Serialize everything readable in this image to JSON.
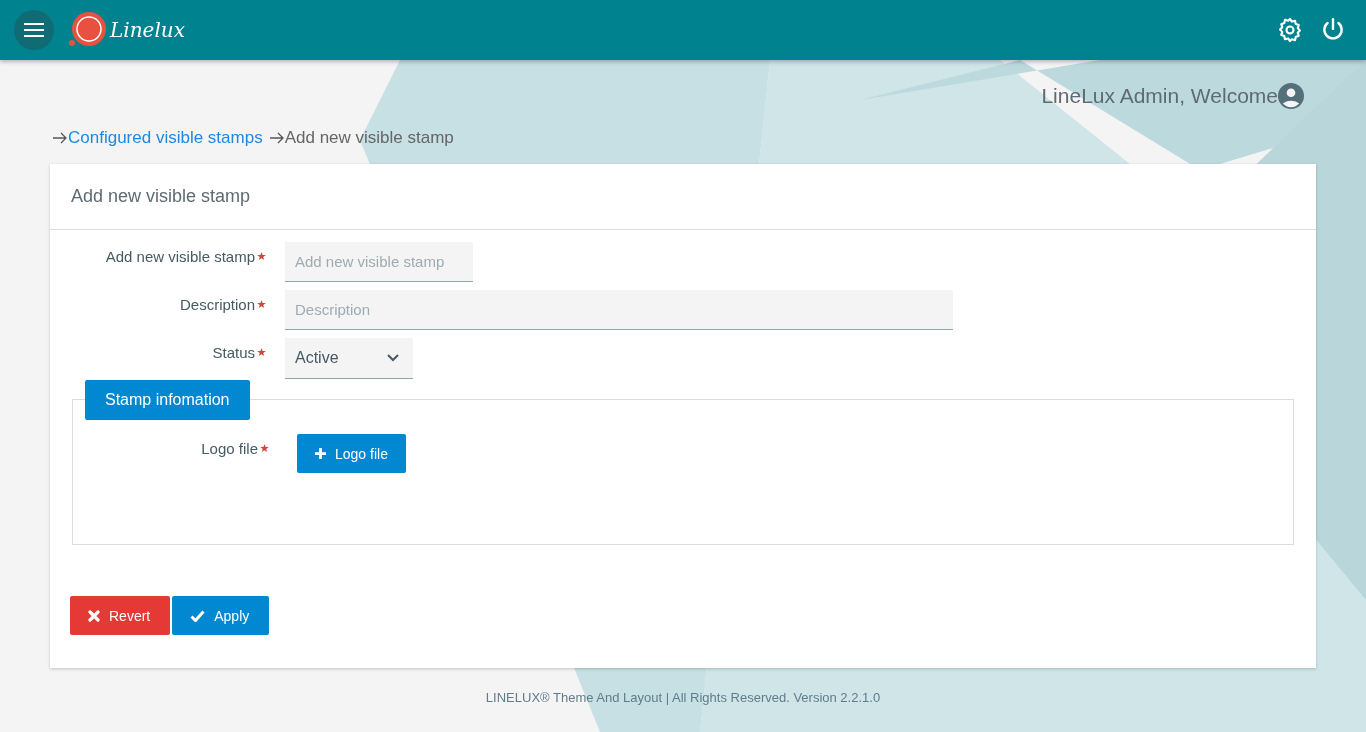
{
  "header": {
    "logo": "Linelux"
  },
  "user": {
    "greeting": "LineLux Admin, Welcome"
  },
  "breadcrumb": [
    {
      "label": "Configured visible stamps",
      "kind": "link"
    },
    {
      "label": "Add new visible stamp",
      "kind": "current"
    }
  ],
  "card": {
    "title": "Add new visible stamp",
    "fields": [
      {
        "label": "Add new visible stamp",
        "kind": "text",
        "placeholder": "Add new visible stamp",
        "required": true
      },
      {
        "label": "Description",
        "kind": "text",
        "placeholder": "Description",
        "required": true
      },
      {
        "label": "Status",
        "kind": "select",
        "value": "Active",
        "required": true
      }
    ],
    "section": {
      "title": "Stamp infomation",
      "file_label": "Logo file",
      "required": true,
      "button": "Logo file"
    },
    "buttons": [
      {
        "label": "Revert",
        "kind": "revert"
      },
      {
        "label": "Apply",
        "kind": "apply"
      }
    ]
  },
  "footer": "LINELUX® Theme And Layout | All Rights Reserved. Version 2.2.1.0"
}
